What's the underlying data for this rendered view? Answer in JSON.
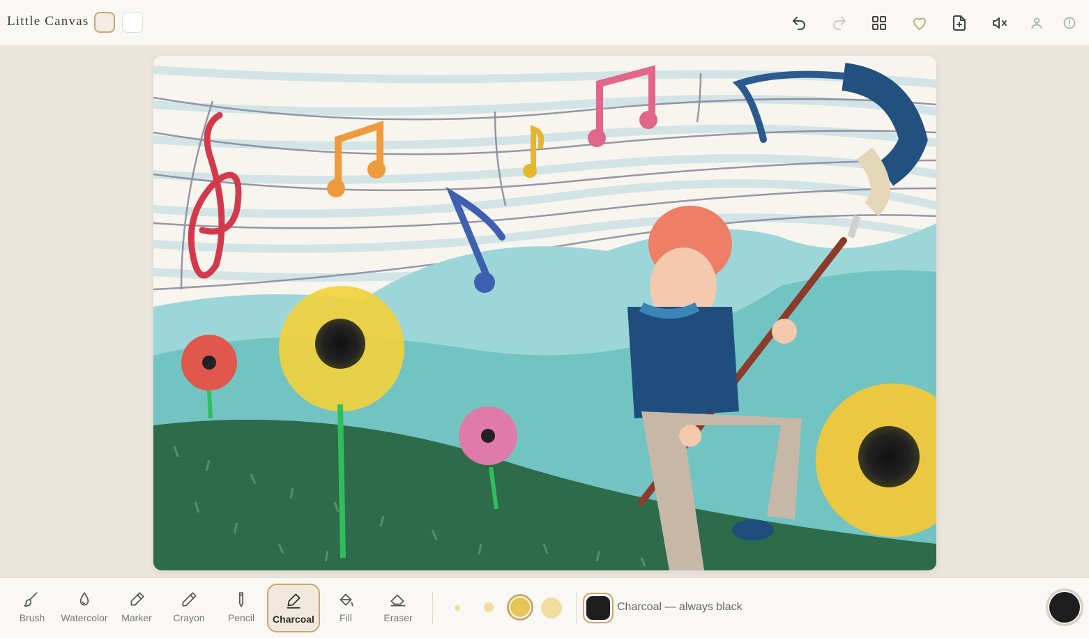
{
  "app": {
    "title": "Little Canvas"
  },
  "topbar": {
    "theme_swatches": [
      "cream-swatch",
      "white-swatch"
    ],
    "icons": [
      {
        "name": "undo-icon",
        "enabled": true
      },
      {
        "name": "redo-icon",
        "enabled": false
      },
      {
        "name": "gallery-grid-icon",
        "enabled": true
      },
      {
        "name": "favorite-heart-icon",
        "enabled": true
      },
      {
        "name": "new-page-icon",
        "enabled": true
      },
      {
        "name": "mute-sound-icon",
        "enabled": true
      },
      {
        "name": "profile-icon",
        "enabled": false
      },
      {
        "name": "info-icon",
        "enabled": false
      }
    ]
  },
  "tools": [
    {
      "id": "brush",
      "label": "Brush",
      "icon": "brush-icon"
    },
    {
      "id": "watercolor",
      "label": "Watercolor",
      "icon": "droplet-icon"
    },
    {
      "id": "marker",
      "label": "Marker",
      "icon": "marker-icon"
    },
    {
      "id": "crayon",
      "label": "Crayon",
      "icon": "crayon-icon"
    },
    {
      "id": "pencil",
      "label": "Pencil",
      "icon": "pencil-icon"
    },
    {
      "id": "charcoal",
      "label": "Charcoal",
      "icon": "charcoal-icon",
      "active": true
    },
    {
      "id": "fill",
      "label": "Fill",
      "icon": "fill-bucket-icon"
    },
    {
      "id": "eraser",
      "label": "Eraser",
      "icon": "eraser-icon"
    }
  ],
  "brush_sizes": {
    "count": 4,
    "selected_index": 2
  },
  "current_color": {
    "hex": "#1e1e1e",
    "hint": "Charcoal — always black"
  },
  "colors": {
    "accent": "#c9a96b",
    "size_dot": "#e6c455",
    "size_dot_light": "#f0dea0"
  }
}
